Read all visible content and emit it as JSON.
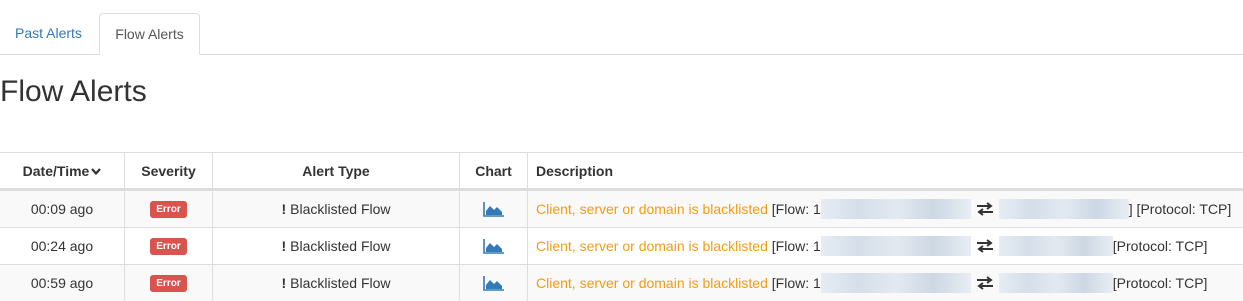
{
  "tabs": [
    {
      "label": "Past Alerts",
      "active": false
    },
    {
      "label": "Flow Alerts",
      "active": true
    }
  ],
  "page_title": "Flow Alerts",
  "table": {
    "headers": {
      "date": "Date/Time",
      "severity": "Severity",
      "alert_type": "Alert Type",
      "chart": "Chart",
      "description": "Description"
    },
    "rows": [
      {
        "date": "00:09 ago",
        "severity": "Error",
        "alert_type": "Blacklisted Flow",
        "desc_highlight": "Client, server or domain is blacklisted",
        "flow_prefix": "[Flow: 1",
        "flow_suffix": "] [Protocol: TCP]"
      },
      {
        "date": "00:24 ago",
        "severity": "Error",
        "alert_type": "Blacklisted Flow",
        "desc_highlight": "Client, server or domain is blacklisted",
        "flow_prefix": "[Flow: 1",
        "flow_suffix": "[Protocol: TCP]"
      },
      {
        "date": "00:59 ago",
        "severity": "Error",
        "alert_type": "Blacklisted Flow",
        "desc_highlight": "Client, server or domain is blacklisted",
        "flow_prefix": "[Flow: 1",
        "flow_suffix": "[Protocol: TCP]"
      }
    ]
  },
  "icons": {
    "sort": "chevron-down-icon",
    "chart": "area-chart-icon",
    "alert": "exclamation-icon",
    "flow": "bidirectional-arrows-icon"
  },
  "colors": {
    "link": "#337ab7",
    "error_badge": "#d9534f",
    "description_highlight": "#f39c12",
    "chart_icon": "#337ab7"
  }
}
